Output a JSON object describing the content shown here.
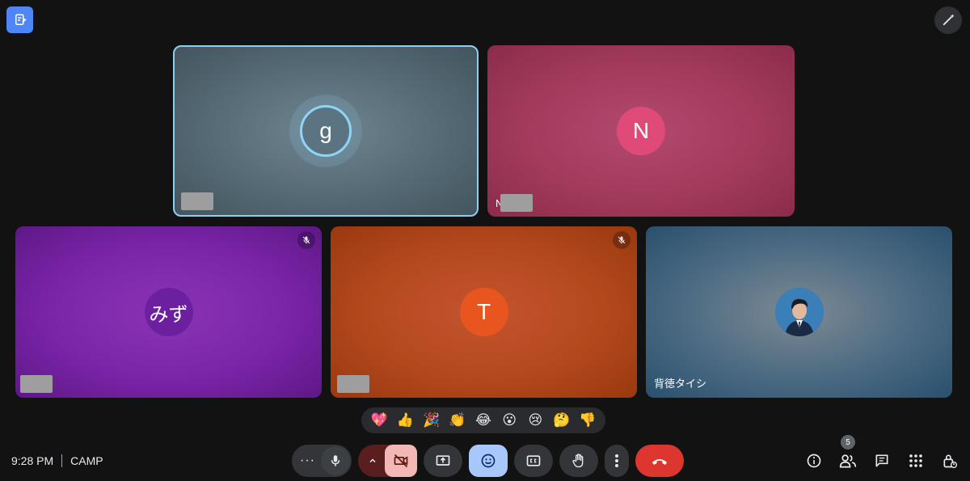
{
  "participants": [
    {
      "id": "g",
      "avatar_letter": "g",
      "name": "",
      "speaking": true,
      "muted": false,
      "color": "#5c7482"
    },
    {
      "id": "n",
      "avatar_letter": "N",
      "name": "",
      "name_prefix": "N",
      "muted": false,
      "color": "#e04a78"
    },
    {
      "id": "mizu",
      "avatar_letter": "みず",
      "name": "",
      "muted": true,
      "color": "#6c20a0"
    },
    {
      "id": "t",
      "avatar_letter": "T",
      "name": "",
      "muted": true,
      "color": "#e8551e"
    },
    {
      "id": "self",
      "avatar_letter": "",
      "name": "背徳タイシ",
      "muted": false,
      "color": "#3a6d9b"
    }
  ],
  "reactions": [
    "💖",
    "👍",
    "🎉",
    "👏",
    "😂",
    "😮",
    "😢",
    "🤔",
    "👎"
  ],
  "meeting": {
    "time": "9:28 PM",
    "code": "CAMP"
  },
  "controls": {
    "more_options": "···",
    "people_count": "5"
  },
  "colors": {
    "accent": "#a8c7fa",
    "end_call": "#dc362e",
    "camera_off": "#f2b8b5",
    "speaking_ring": "#8ed4f5"
  }
}
